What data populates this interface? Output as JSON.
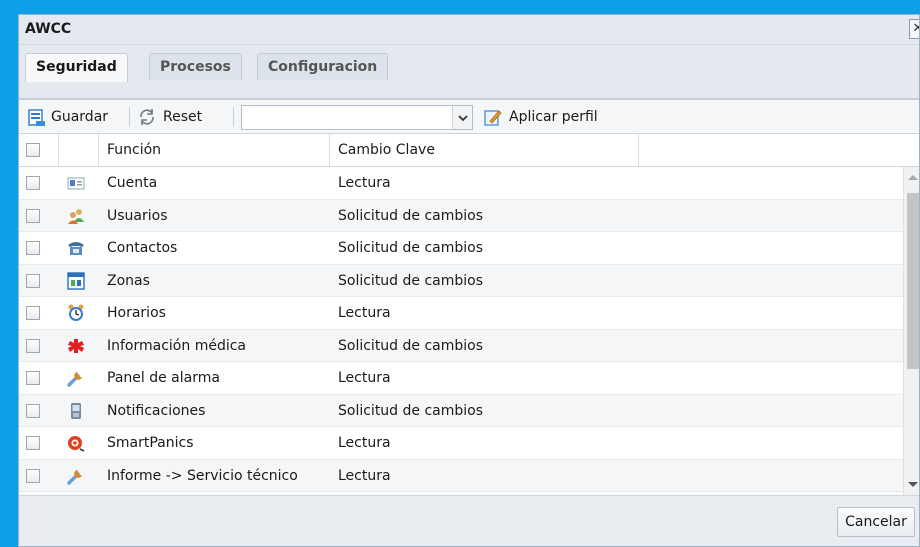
{
  "window": {
    "title": "AWCC",
    "close_glyph": "✕"
  },
  "tabs": [
    {
      "label": "Seguridad",
      "active": true
    },
    {
      "label": "Procesos",
      "active": false
    },
    {
      "label": "Configuracion",
      "active": false
    }
  ],
  "toolbar": {
    "save_label": "Guardar",
    "save_icon": "save-icon",
    "reset_label": "Reset",
    "reset_icon": "refresh-icon",
    "profile_value": "",
    "apply_label": "Aplicar perfil",
    "apply_icon": "edit-icon"
  },
  "grid": {
    "columns": [
      "Función",
      "Cambio Clave"
    ],
    "rows": [
      {
        "function": "Cuenta",
        "change": "Lectura",
        "icon": "id-card-icon"
      },
      {
        "function": "Usuarios",
        "change": "Solicitud de cambios",
        "icon": "users-icon"
      },
      {
        "function": "Contactos",
        "change": "Solicitud de cambios",
        "icon": "phone-icon"
      },
      {
        "function": "Zonas",
        "change": "Solicitud de cambios",
        "icon": "zones-icon"
      },
      {
        "function": "Horarios",
        "change": "Lectura",
        "icon": "alarm-clock-icon"
      },
      {
        "function": "Información médica",
        "change": "Solicitud de cambios",
        "icon": "medical-icon"
      },
      {
        "function": "Panel de alarma",
        "change": "Lectura",
        "icon": "wrench-icon"
      },
      {
        "function": "Notificaciones",
        "change": "Solicitud de cambios",
        "icon": "mobile-phone-icon"
      },
      {
        "function": "SmartPanics",
        "change": "Lectura",
        "icon": "panic-icon"
      },
      {
        "function": "Informe -> Servicio técnico",
        "change": "Lectura",
        "icon": "wrench-icon"
      }
    ]
  },
  "footer": {
    "cancel_label": "Cancelar"
  },
  "colors": {
    "frame": "#0f9fe6",
    "dialog_bg": "#e9ecf0",
    "accent_blue": "#1f7fd1"
  }
}
